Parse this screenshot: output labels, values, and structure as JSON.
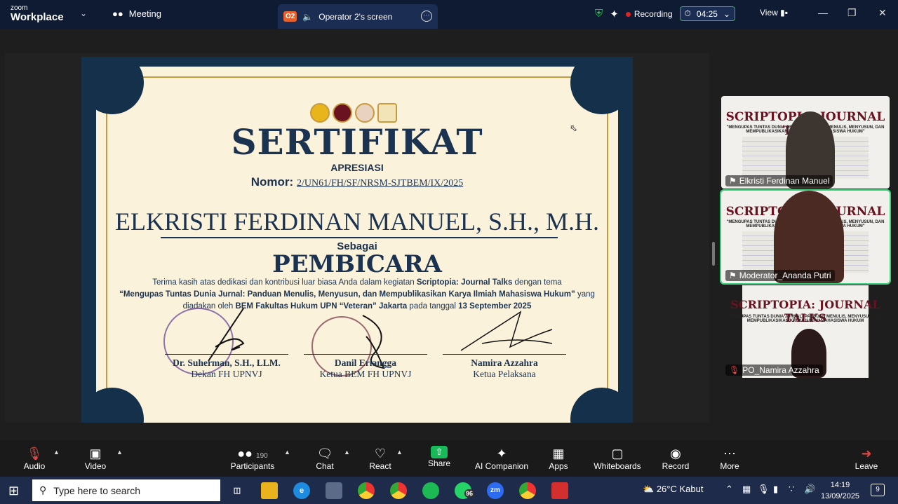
{
  "app": {
    "brand_top": "zoom",
    "brand_bottom": "Workplace"
  },
  "topbar": {
    "meeting_label": "Meeting",
    "share_badge": "O2",
    "share_title": "Operator 2's screen",
    "recording_label": "Recording",
    "timer": "04:25",
    "view_label": "View"
  },
  "certificate": {
    "title": "SERTIFIKAT",
    "subtitle": "APRESIASI",
    "nomor_label": "Nomor:",
    "nomor_value": "2/UN61/FH/SF/NRSM-SJTBEM/IX/2025",
    "recipient": "ELKRISTI FERDINAN MANUEL, S.H., M.H.",
    "as_label": "Sebagai",
    "role": "PEMBICARA",
    "body": {
      "line1_a": "Terima kasih atas dedikasi dan kontribusi luar biasa Anda dalam kegiatan ",
      "line1_event": "Scriptopia: Journal Talks",
      "line1_b": " dengan tema",
      "theme": "“Mengupas Tuntas Dunia Jurnal: Panduan Menulis, Menyusun, dan  Mempublikasikan Karya Ilmiah Mahasiswa Hukum”",
      "line3_a": " yang diadakan oleh ",
      "organizer": "BEM Fakultas Hukum UPN “Veteran” Jakarta",
      "line3_b": " pada tanggal ",
      "date": "13 September 2025"
    },
    "signatories": [
      {
        "name": "Dr. Suherman, S.H., LLM.",
        "role": "Dekan FH UPNVJ"
      },
      {
        "name": "Danil Erlangga",
        "role": "Ketua BEM FH UPNVJ"
      },
      {
        "name": "Namira Azzahra",
        "role": "Ketua Pelaksana"
      }
    ]
  },
  "videos": [
    {
      "name": "Elkristi Ferdinan Manuel",
      "banner": "SCRIPTOPIA: JOURNAL TALKS",
      "sub": "\"MENGUPAS TUNTAS DUNIA JURNAL: PANDUAN MENULIS, MENYUSUN, DAN MEMPUBLIKASIKAN KARYA ILMIAH MAHASISWA HUKUM\""
    },
    {
      "name": "Moderator_Ananda Putri",
      "banner": "SCRIPTOPIA: JOURNAL TALKS",
      "sub": "\"MENGUPAS TUNTAS DUNIA JURNAL: PANDUAN MENULIS, MENYUSUN, DAN MEMPUBLIKASIKAN KARYA ILMIAH MAHASISWA HUKUM\""
    },
    {
      "name": "PO_Namira Azzahra",
      "banner": "SCRIPTOPIA: JOURNAL TALKS",
      "sub": "MENGUPAS TUNTAS DUNIA JURNAL: PANDUAN MENULIS, MENYUSUN, DAN MEMPUBLIKASIKAN KARYA ILMIAH MAHASISWA HUKUM"
    }
  ],
  "toolbar": {
    "audio": "Audio",
    "video": "Video",
    "participants": "Participants",
    "participants_count": "190",
    "chat": "Chat",
    "react": "React",
    "share": "Share",
    "ai": "AI Companion",
    "apps": "Apps",
    "whiteboards": "Whiteboards",
    "record": "Record",
    "more": "More",
    "leave": "Leave"
  },
  "taskbar": {
    "search_placeholder": "Type here to search",
    "whatsapp_badge": "96",
    "weather": "26°C  Kabut",
    "time": "14:19",
    "date": "13/09/2025",
    "notifications": "9"
  },
  "colors": {
    "accent_green": "#2dbb4e",
    "record_red": "#e02424",
    "cert_navy": "#14304a",
    "cert_gold": "#c79a3e"
  }
}
